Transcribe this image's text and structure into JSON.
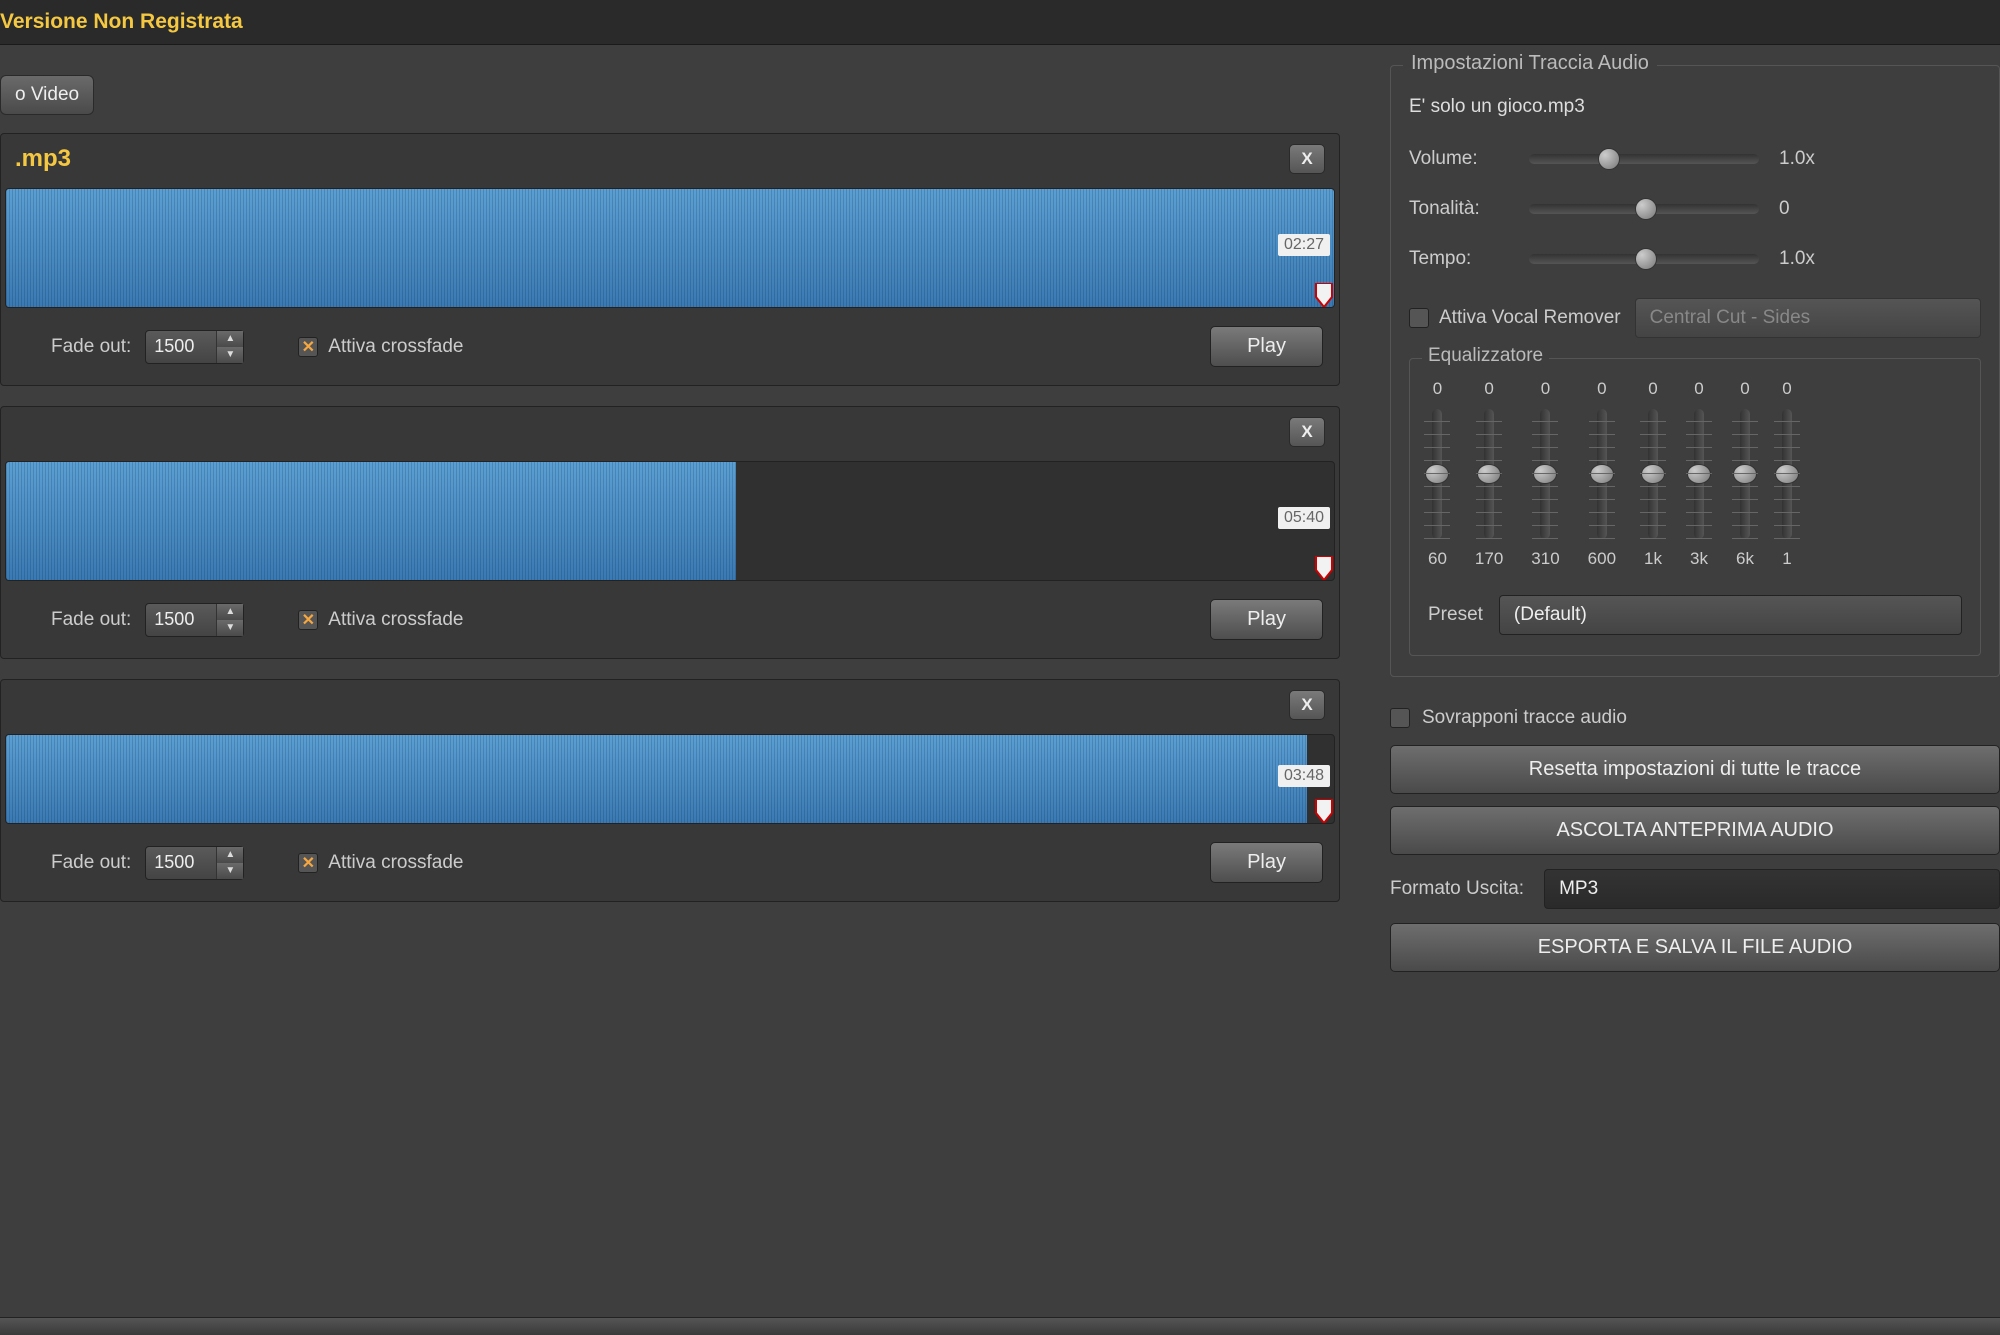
{
  "app": {
    "title": "Versione Non Registrata",
    "add_button": "o Video"
  },
  "tracks": [
    {
      "title": ".mp3",
      "close": "X",
      "time": "02:27",
      "wave_width": "100%",
      "fade_out_label": "Fade out:",
      "fade_out_value": "1500",
      "crossfade_checked": true,
      "crossfade_label": "Attiva crossfade",
      "play": "Play"
    },
    {
      "title": "",
      "close": "X",
      "time": "05:40",
      "wave_width": "55%",
      "fade_out_label": "Fade out:",
      "fade_out_value": "1500",
      "crossfade_checked": true,
      "crossfade_label": "Attiva crossfade",
      "play": "Play"
    },
    {
      "title": "",
      "close": "X",
      "time": "03:48",
      "wave_width": "98%",
      "fade_out_label": "Fade out:",
      "fade_out_value": "1500",
      "crossfade_checked": true,
      "crossfade_label": "Attiva crossfade",
      "play": "Play"
    }
  ],
  "settings": {
    "group_title": "Impostazioni Traccia Audio",
    "filename": "E' solo un gioco.mp3",
    "volume_label": "Volume:",
    "volume_value": "1.0x",
    "volume_pos": "30%",
    "tone_label": "Tonalità:",
    "tone_value": "0",
    "tone_pos": "46%",
    "tempo_label": "Tempo:",
    "tempo_value": "1.0x",
    "tempo_pos": "46%",
    "vocal_remover_label": "Attiva Vocal Remover",
    "vocal_remover_mode": "Central Cut - Sides",
    "eq_title": "Equalizzatore",
    "eq": [
      {
        "val": "0",
        "band": "60"
      },
      {
        "val": "0",
        "band": "170"
      },
      {
        "val": "0",
        "band": "310"
      },
      {
        "val": "0",
        "band": "600"
      },
      {
        "val": "0",
        "band": "1k"
      },
      {
        "val": "0",
        "band": "3k"
      },
      {
        "val": "0",
        "band": "6k"
      },
      {
        "val": "0",
        "band": "1"
      }
    ],
    "preset_label": "Preset",
    "preset_value": "(Default)"
  },
  "footer": {
    "overlap_label": "Sovrapponi tracce audio",
    "reset_button": "Resetta impostazioni di tutte le tracce",
    "preview_button": "ASCOLTA ANTEPRIMA AUDIO",
    "format_label": "Formato Uscita:",
    "format_value": "MP3",
    "export_button": "ESPORTA E SALVA IL FILE AUDIO"
  }
}
